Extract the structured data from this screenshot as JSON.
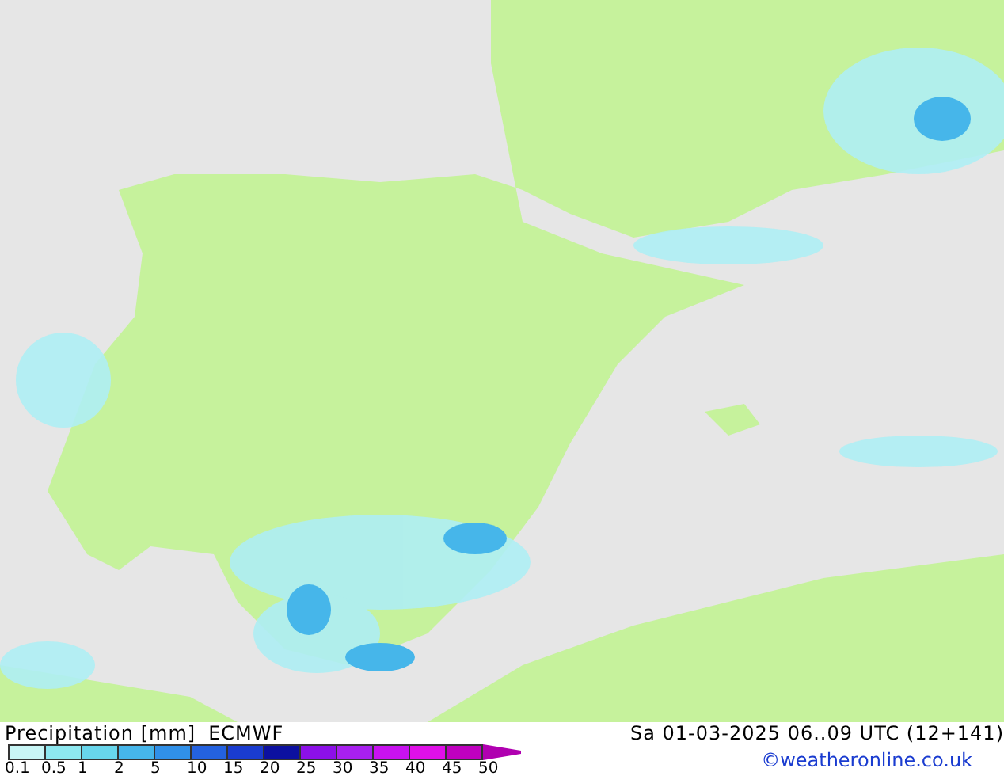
{
  "map": {
    "title": "Precipitation [mm]",
    "model": "ECMWF",
    "valid_time": "Sa 01-03-2025 06..09 UTC (12+141)"
  },
  "legend": {
    "bins": [
      {
        "color": "#c8f6f6"
      },
      {
        "color": "#8ee8f0"
      },
      {
        "color": "#68d6ec"
      },
      {
        "color": "#46b6ea"
      },
      {
        "color": "#3090e8"
      },
      {
        "color": "#2462e0"
      },
      {
        "color": "#1a3cd0"
      },
      {
        "color": "#0c10a0"
      },
      {
        "color": "#8c10e8"
      },
      {
        "color": "#a820f0"
      },
      {
        "color": "#c812f0"
      },
      {
        "color": "#e010e8"
      },
      {
        "color": "#c000c0"
      }
    ],
    "ticks": [
      "0.1",
      "0.5",
      "1",
      "2",
      "5",
      "10",
      "15",
      "20",
      "25",
      "30",
      "35",
      "40",
      "45",
      "50"
    ]
  },
  "credit": "©weatheronline.co.uk"
}
